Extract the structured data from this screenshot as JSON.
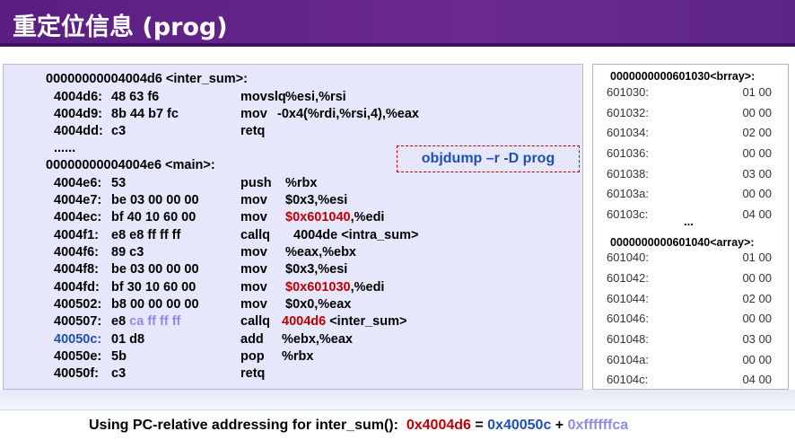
{
  "slide": {
    "title": "重定位信息 (prog)"
  },
  "disasm": {
    "inter_label": "00000000004004d6 <inter_sum>:",
    "inter": [
      {
        "addr": "4004d6:",
        "bytes": "48 63 f6",
        "mnemonic": "movslq",
        "operands": "%esi,%rsi"
      },
      {
        "addr": "4004d9:",
        "bytes": "8b 44 b7 fc",
        "mnemonic": "mov",
        "operands": "-0x4(%rdi,%rsi,4),%eax"
      },
      {
        "addr": "4004dd:",
        "bytes": "c3",
        "mnemonic": "retq",
        "operands": ""
      }
    ],
    "ellipsis": "......",
    "main_label": "00000000004004e6 <main>:",
    "main": [
      {
        "addr": "4004e6:",
        "bytes": "53",
        "mnemonic": "push",
        "operands": "%rbx"
      },
      {
        "addr": "4004e7:",
        "bytes": "be 03 00 00 00",
        "mnemonic": "mov",
        "operands": "$0x3,%esi"
      },
      {
        "addr": "4004ec:",
        "bytes": "bf 40 10 60 00",
        "mnemonic": "mov",
        "op_red": "$0x601040",
        "op_rest": ",%edi"
      },
      {
        "addr": "4004f1:",
        "bytes": "e8 e8 ff ff ff",
        "mnemonic": "callq",
        "operands": "4004de <intra_sum>"
      },
      {
        "addr": "4004f6:",
        "bytes": "89 c3",
        "mnemonic": "mov",
        "operands": "%eax,%ebx"
      },
      {
        "addr": "4004f8:",
        "bytes": "be 03 00 00 00",
        "mnemonic": "mov",
        "operands": "$0x3,%esi"
      },
      {
        "addr": "4004fd:",
        "bytes": "bf 30 10 60 00",
        "mnemonic": "mov",
        "op_red": "$0x601030",
        "op_rest": ",%edi"
      },
      {
        "addr": "400502:",
        "bytes": "b8 00 00 00 00",
        "mnemonic": "mov",
        "operands": "$0x0,%eax"
      },
      {
        "addr": "400507:",
        "bytes_lead": "e8 ",
        "bytes_hl": "ca ff ff ff",
        "mnemonic": "callq",
        "op_red": "4004d6",
        "op_rest": " <inter_sum>"
      },
      {
        "addr": "40050c:",
        "bytes": "01 d8",
        "mnemonic": "add",
        "operands": "%ebx,%eax"
      },
      {
        "addr": "40050e:",
        "bytes": "5b",
        "mnemonic": "pop",
        "operands": "%rbx"
      },
      {
        "addr": "40050f:",
        "bytes": "c3",
        "mnemonic": "retq",
        "operands": ""
      }
    ]
  },
  "command": "objdump –r -D prog",
  "memory": {
    "brray_label": "0000000000601030<brray>:",
    "brray": [
      {
        "addr": "601030:",
        "val": "01 00"
      },
      {
        "addr": "601032:",
        "val": "00 00"
      },
      {
        "addr": "601034:",
        "val": "02 00"
      },
      {
        "addr": "601036:",
        "val": "00 00"
      },
      {
        "addr": "601038:",
        "val": "03 00"
      },
      {
        "addr": "60103a:",
        "val": "00 00"
      },
      {
        "addr": "60103c:",
        "val": "04 00"
      }
    ],
    "ellipsis": "...",
    "array_label": "0000000000601040<array>:",
    "array": [
      {
        "addr": "601040:",
        "val": "01 00"
      },
      {
        "addr": "601042:",
        "val": "00 00"
      },
      {
        "addr": "601044:",
        "val": "02 00"
      },
      {
        "addr": "601046:",
        "val": "00 00"
      },
      {
        "addr": "601048:",
        "val": "03 00"
      },
      {
        "addr": "60104a:",
        "val": "00 00"
      },
      {
        "addr": "60104c:",
        "val": "04 00"
      }
    ]
  },
  "footer": {
    "prefix": "Using PC-relative addressing for inter_sum():  ",
    "target": "0x4004d6",
    "eq": " = ",
    "pc": "0x40050c",
    "plus": " + ",
    "offset": "0xffffffca"
  },
  "colors": {
    "header": "#5a1d80",
    "red": "#c00000",
    "blue": "#1f4fb8",
    "lavender": "#8c8ce6",
    "code_bg": "#e7e7fb"
  }
}
